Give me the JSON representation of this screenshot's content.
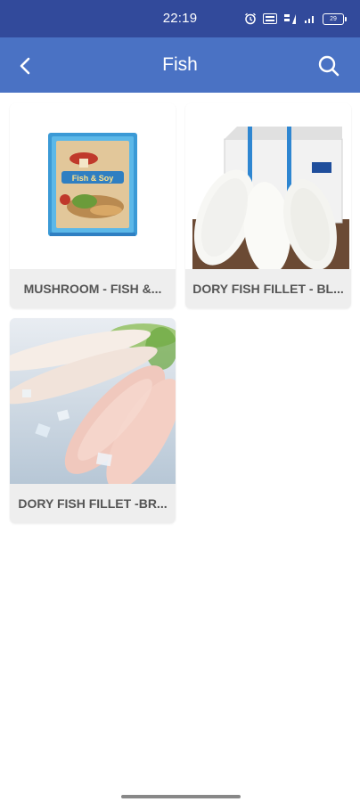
{
  "status_bar": {
    "time": "22:19",
    "battery": "29",
    "icons": [
      "alarm-icon",
      "volte-icon",
      "data-4g-icon",
      "signal-icon",
      "battery-icon"
    ]
  },
  "app_bar": {
    "title": "Fish",
    "back_icon": "back-arrow-icon",
    "search_icon": "search-icon",
    "background": "#4a72c4",
    "status_background": "#324a9b"
  },
  "products": [
    {
      "name": "MUSHROOM - FISH &...",
      "image": "fish-and-soy-package-image"
    },
    {
      "name": "DORY FISH FILLET - BL...",
      "image": "dory-fillet-box-image"
    },
    {
      "name": "DORY FISH FILLET -BR...",
      "image": "dory-fillet-ice-image"
    }
  ]
}
